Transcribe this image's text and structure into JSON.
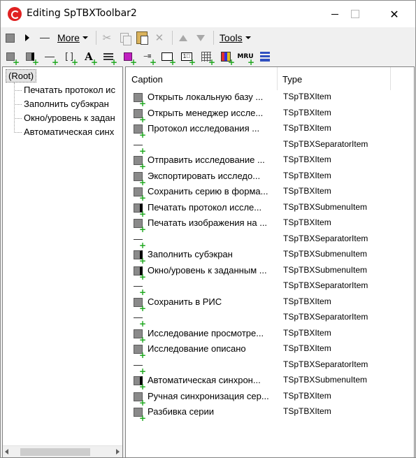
{
  "window": {
    "title": "Editing SpTBXToolbar2",
    "icon": "app-logo-icon",
    "close_glyph": "✕"
  },
  "toolbar1": {
    "more_label": "More",
    "tools_label": "Tools",
    "icons": [
      "item-square-icon",
      "submenu-arrow-icon",
      "separator-line-icon",
      "cut-icon",
      "copy-icon",
      "paste-icon",
      "delete-icon",
      "move-up-icon",
      "move-down-icon"
    ]
  },
  "toolbar2": {
    "mru_label": "MRU",
    "edit_label": "—≡",
    "box_label": "1⃣",
    "icons": [
      "add-item-icon",
      "add-submenu-icon",
      "add-separator-icon",
      "add-break-icon",
      "add-label-icon",
      "add-list-icon",
      "add-color-icon",
      "add-edit-icon",
      "add-box-icon",
      "add-number-icon",
      "add-grid-icon",
      "add-palette-icon",
      "add-mru-icon",
      "add-stack-icon"
    ]
  },
  "tree": {
    "root": "(Root)",
    "items": [
      "Печатать протокол ис",
      "Заполнить субэкран",
      "Окно/уровень к задан",
      "Автоматическая синх"
    ]
  },
  "list": {
    "header_caption": "Caption",
    "header_type": "Type",
    "rows": [
      {
        "kind": "item",
        "caption": "Открыть локальную базу ...",
        "type": "TSpTBXItem"
      },
      {
        "kind": "item",
        "caption": "Открыть менеджер иссле...",
        "type": "TSpTBXItem"
      },
      {
        "kind": "item",
        "caption": "Протокол исследования ...",
        "type": "TSpTBXItem"
      },
      {
        "kind": "separator",
        "caption": "",
        "type": "TSpTBXSeparatorItem"
      },
      {
        "kind": "item",
        "caption": "Отправить исследование ...",
        "type": "TSpTBXItem"
      },
      {
        "kind": "item",
        "caption": "Экспортировать исследо...",
        "type": "TSpTBXItem"
      },
      {
        "kind": "item",
        "caption": "Сохранить серию в форма...",
        "type": "TSpTBXItem"
      },
      {
        "kind": "submenu",
        "caption": "Печатать протокол иссле...",
        "type": "TSpTBXSubmenuItem"
      },
      {
        "kind": "item",
        "caption": "Печатать изображения на ...",
        "type": "TSpTBXItem"
      },
      {
        "kind": "separator",
        "caption": "",
        "type": "TSpTBXSeparatorItem"
      },
      {
        "kind": "submenu",
        "caption": "Заполнить субэкран",
        "type": "TSpTBXSubmenuItem"
      },
      {
        "kind": "submenu",
        "caption": "Окно/уровень к заданным ...",
        "type": "TSpTBXSubmenuItem"
      },
      {
        "kind": "separator",
        "caption": "",
        "type": "TSpTBXSeparatorItem"
      },
      {
        "kind": "item",
        "caption": "Сохранить в РИС",
        "type": "TSpTBXItem"
      },
      {
        "kind": "separator",
        "caption": "",
        "type": "TSpTBXSeparatorItem"
      },
      {
        "kind": "item",
        "caption": "Исследование просмотре...",
        "type": "TSpTBXItem"
      },
      {
        "kind": "item",
        "caption": "Исследование описано",
        "type": "TSpTBXItem"
      },
      {
        "kind": "separator",
        "caption": "",
        "type": "TSpTBXSeparatorItem"
      },
      {
        "kind": "submenu",
        "caption": "Автоматическая синхрон...",
        "type": "TSpTBXSubmenuItem"
      },
      {
        "kind": "item",
        "caption": "Ручная синхронизация сер...",
        "type": "TSpTBXItem"
      },
      {
        "kind": "item",
        "caption": "Разбивка серии",
        "type": "TSpTBXItem"
      }
    ]
  },
  "colors": {
    "add_badge": "#1fa81f",
    "app_icon": "#e02222",
    "disabled_icon": "#a8a8a8"
  }
}
